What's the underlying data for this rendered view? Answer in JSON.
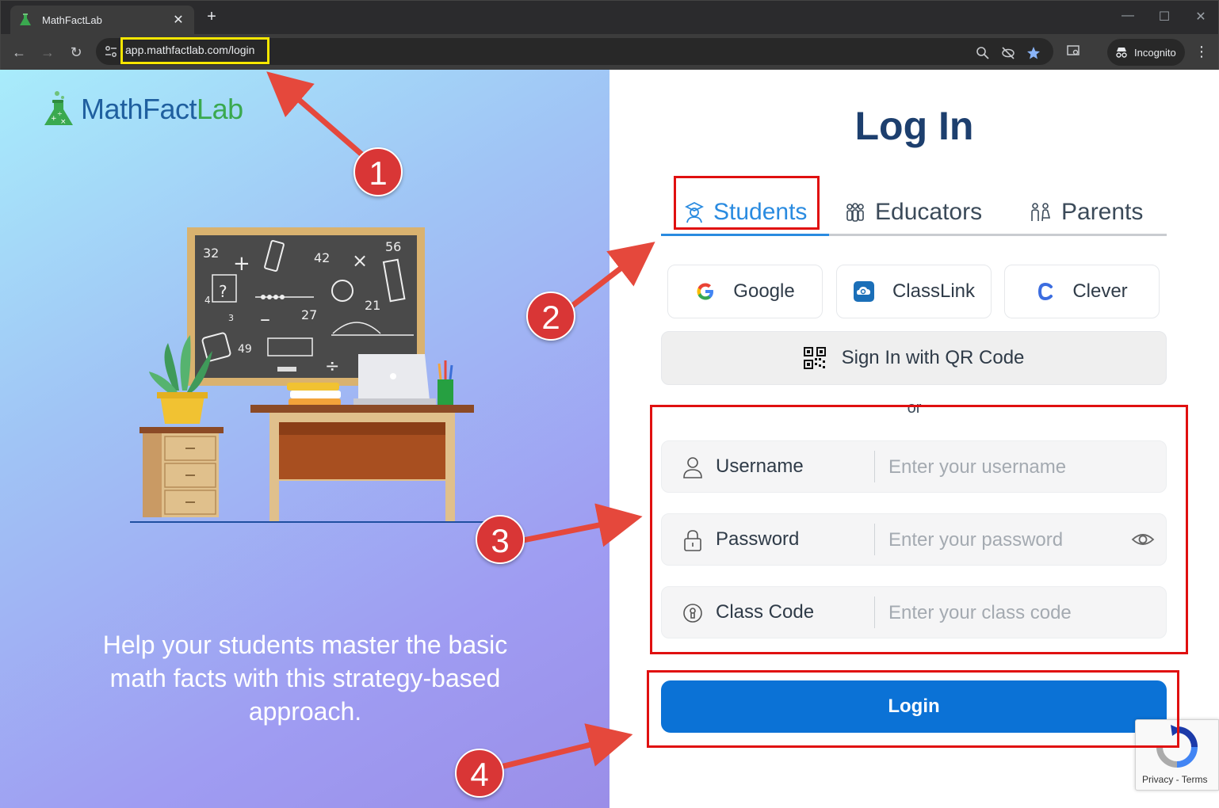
{
  "browser": {
    "tab_title": "MathFactLab",
    "tab_close": "✕",
    "new_tab": "+",
    "url": "app.mathfactlab.com/login",
    "incognito_label": "Incognito"
  },
  "brand": {
    "name_part1": "MathFact",
    "name_part2": "Lab"
  },
  "left": {
    "tagline": "Help your students master the basic math facts with this strategy-based approach.",
    "board_numbers": [
      "32",
      "42",
      "56",
      "27",
      "21",
      "49",
      "4",
      "3"
    ]
  },
  "login": {
    "title": "Log In",
    "role_tabs": [
      {
        "label": "Students",
        "active": true
      },
      {
        "label": "Educators",
        "active": false
      },
      {
        "label": "Parents",
        "active": false
      }
    ],
    "sso": [
      {
        "label": "Google"
      },
      {
        "label": "ClassLink"
      },
      {
        "label": "Clever"
      }
    ],
    "qr_label": "Sign In with QR Code",
    "or_text": "or",
    "fields": {
      "username": {
        "label": "Username",
        "placeholder": "Enter your username",
        "value": ""
      },
      "password": {
        "label": "Password",
        "placeholder": "Enter your password",
        "value": ""
      },
      "classcode": {
        "label": "Class Code",
        "placeholder": "Enter your class code",
        "value": ""
      }
    },
    "submit_label": "Login",
    "recaptcha_text": "Privacy - Terms"
  },
  "annotations": {
    "badges": [
      "1",
      "2",
      "3",
      "4"
    ],
    "box_color": "#e01010",
    "url_box_color": "#f6e600",
    "arrow_color": "#e5483c"
  },
  "colors": {
    "primary": "#0b72d6",
    "active_tab": "#2a8be0",
    "title": "#1d3f6e"
  }
}
